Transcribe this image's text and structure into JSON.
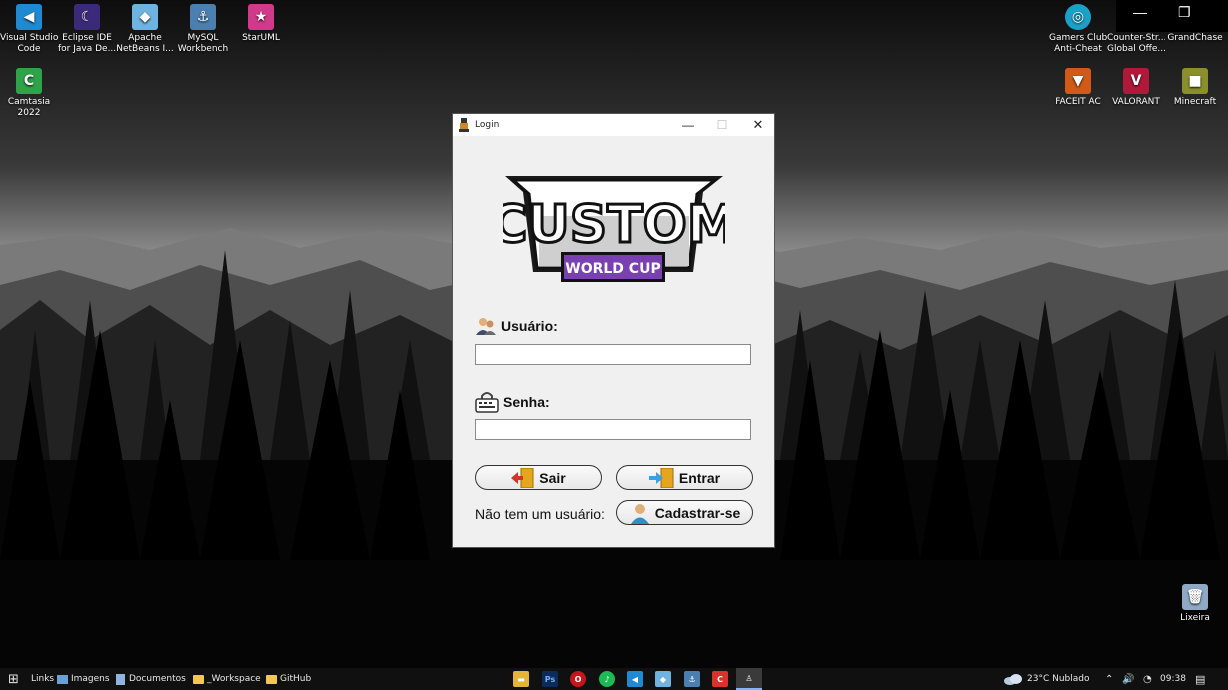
{
  "desktop_icons_left": [
    {
      "name": "Visual Studio Code",
      "line1": "Visual Studio",
      "line2": "Code",
      "color": "#1f8ad2",
      "glyph": "◀"
    },
    {
      "name": "Eclipse IDE",
      "line1": "Eclipse IDE",
      "line2": "for Java De...",
      "color": "#3b2a7a",
      "glyph": "☾"
    },
    {
      "name": "Apache NetBeans",
      "line1": "Apache",
      "line2": "NetBeans I...",
      "color": "#6fb3e0",
      "glyph": "◆"
    },
    {
      "name": "MySQL Workbench",
      "line1": "MySQL",
      "line2": "Workbench",
      "color": "#4a7fb0",
      "glyph": "⚓"
    },
    {
      "name": "StarUML",
      "line1": "StarUML",
      "line2": "",
      "color": "#d03a8a",
      "glyph": "★"
    },
    {
      "name": "Camtasia 2022",
      "line1": "Camtasia",
      "line2": "2022",
      "color": "#2fa34a",
      "glyph": "C"
    }
  ],
  "desktop_icons_right": [
    {
      "name": "Gamers Club Anti-Cheat",
      "line1": "Gamers Club",
      "line2": "Anti-Cheat",
      "color": "#1aa1c7",
      "glyph": "◎"
    },
    {
      "name": "Counter-Strike",
      "line1": "Counter-Str...",
      "line2": "Global Offe...",
      "color": "#2b2b2b",
      "glyph": ""
    },
    {
      "name": "GrandChase",
      "line1": "GrandChase",
      "line2": "",
      "color": "#2b2b2b",
      "glyph": ""
    },
    {
      "name": "FACEIT AC",
      "line1": "FACEIT AC",
      "line2": "",
      "color": "#d25a18",
      "glyph": "▼"
    },
    {
      "name": "VALORANT",
      "line1": "VALORANT",
      "line2": "",
      "color": "#b0193a",
      "glyph": "V"
    },
    {
      "name": "Minecraft",
      "line1": "Minecraft",
      "line2": "",
      "color": "#8a8f2a",
      "glyph": "■"
    },
    {
      "name": "Lixeira",
      "line1": "Lixeira",
      "line2": "",
      "color": "#8fa9c4",
      "glyph": "🗑"
    }
  ],
  "window_controls": {
    "minimize": "—",
    "restore": "❐"
  },
  "login": {
    "title": "Login",
    "minimize": "—",
    "maximize": "☐",
    "close": "✕",
    "logo_text": "CUSTOM",
    "logo_badge": "WORLD CUP",
    "user_label": "Usuário:",
    "user_value": "",
    "password_label": "Senha:",
    "password_value": "",
    "exit_button": "Sair",
    "enter_button": "Entrar",
    "no_user_text": "Não tem um usuário:",
    "register_button": "Cadastrar-se"
  },
  "taskbar": {
    "start": "⊞",
    "links": "Links",
    "imagens": "Imagens",
    "documentos": "Documentos",
    "workspace": "_Workspace",
    "github": "GitHub",
    "apps": [
      {
        "name": "File Explorer",
        "color": "#e3b53a",
        "glyph": "▬"
      },
      {
        "name": "Photoshop",
        "color": "#0c2a5a",
        "glyph": "Ps"
      },
      {
        "name": "Opera",
        "color": "#c4161c",
        "glyph": "O"
      },
      {
        "name": "Spotify",
        "color": "#1db954",
        "glyph": "♪"
      },
      {
        "name": "VS Code",
        "color": "#1f8ad2",
        "glyph": "◀"
      },
      {
        "name": "NetBeans",
        "color": "#6fb3e0",
        "glyph": "◆"
      },
      {
        "name": "MySQL Workbench",
        "color": "#4a7fb0",
        "glyph": "⚓"
      },
      {
        "name": "Camtasia",
        "color": "#d8322a",
        "glyph": "C"
      },
      {
        "name": "Java App",
        "color": "#3a3a3a",
        "glyph": "♙"
      }
    ],
    "weather": "23°C Nublado",
    "time": "09:38"
  }
}
